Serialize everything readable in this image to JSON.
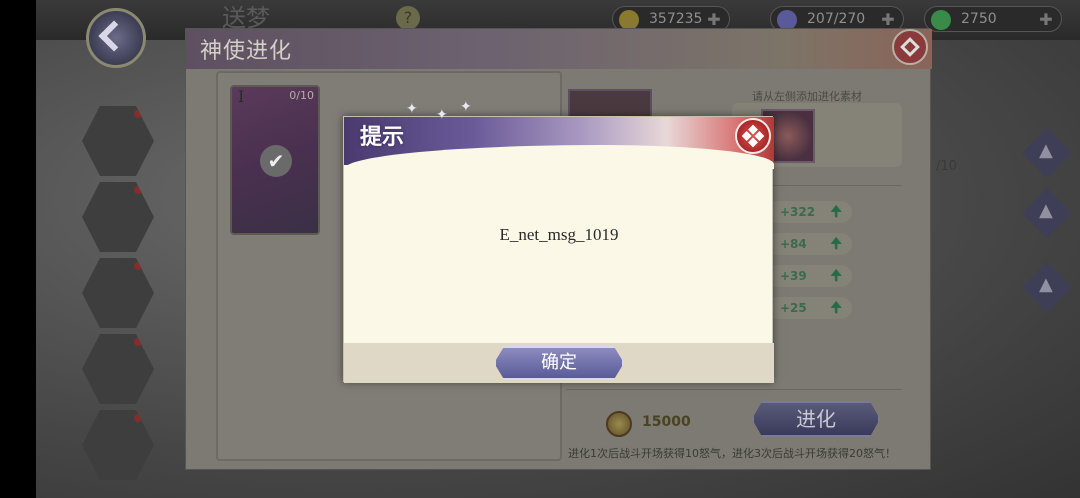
{
  "background": {
    "title": "送梦",
    "resources": [
      {
        "icon": "gold-coin-icon",
        "value": "357235",
        "color": "#8a7a30"
      },
      {
        "icon": "crystal-icon",
        "value": "207/270",
        "color": "#5a5a9a"
      },
      {
        "icon": "green-gem-icon",
        "value": "2750",
        "color": "#3a8a4a"
      }
    ]
  },
  "panel": {
    "title": "神使进化",
    "card_count": "0/10",
    "card_roman": "I",
    "hint": "请从左侧添加进化素材",
    "level_suffix": "/10",
    "bonuses": [
      "+322",
      "+84",
      "+39",
      "+25"
    ],
    "cost": "15000",
    "evolve_label": "进化",
    "footnote": "进化1次后战斗开场获得10怒气，进化3次后战斗开场获得20怒气！"
  },
  "dialog": {
    "title": "提示",
    "message": "E_net_msg_1019",
    "confirm_label": "确定"
  }
}
